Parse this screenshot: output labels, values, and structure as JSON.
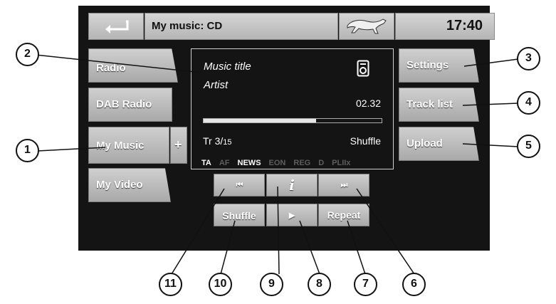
{
  "header": {
    "title": "My music: CD",
    "clock": "17:40"
  },
  "left_menu": {
    "radio": "Radio",
    "dab_radio": "DAB Radio",
    "my_music": "My Music",
    "plus": "+",
    "my_video": "My Video"
  },
  "right_menu": {
    "settings": "Settings",
    "track_list": "Track list",
    "upload": "Upload"
  },
  "now_playing": {
    "title": "Music title",
    "artist": "Artist",
    "time": "02.32",
    "progress": 0.63,
    "track_label": "Tr 3/",
    "track_total": "15",
    "mode": "Shuffle",
    "flags": {
      "ta": "TA",
      "af": "AF",
      "news": "NEWS",
      "eon": "EON",
      "reg": "REG",
      "d": "D",
      "pl2x": "PLIIx"
    }
  },
  "controls": {
    "prev": "⏮",
    "info": "i",
    "next": "⏭",
    "shuffle": "Shuffle",
    "play": "▶",
    "repeat": "Repeat"
  },
  "callouts": {
    "c1": "1",
    "c2": "2",
    "c3": "3",
    "c4": "4",
    "c5": "5",
    "c6": "6",
    "c7": "7",
    "c8": "8",
    "c9": "9",
    "c10": "10",
    "c11": "11"
  },
  "icons": {
    "back": "back-arrow-icon",
    "logo": "jaguar-leaper-logo",
    "device": "cd-player-icon"
  },
  "colors": {
    "screen_bg": "#141414",
    "button": "#bdbdbd",
    "text": "#ffffff"
  }
}
